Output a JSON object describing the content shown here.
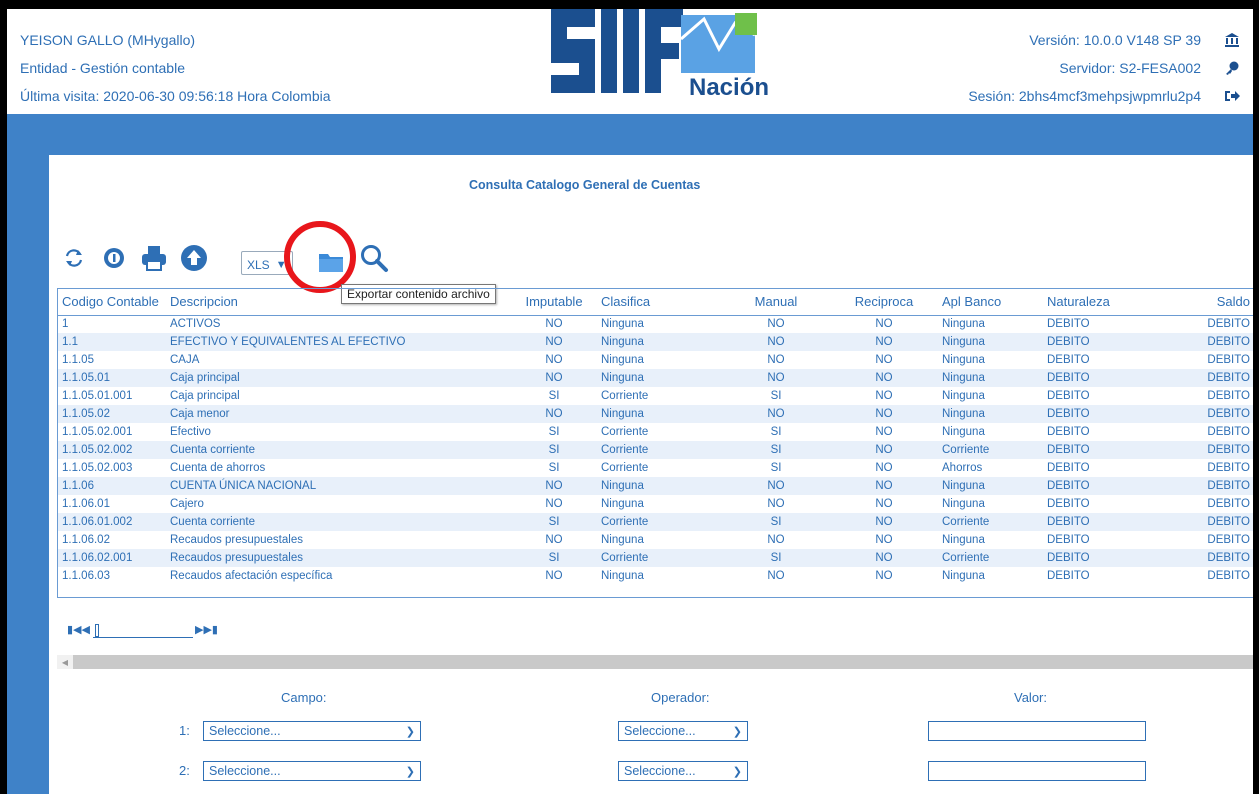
{
  "header": {
    "user": "YEISON GALLO (MHygallo)",
    "entity": "Entidad - Gestión contable",
    "last_visit": "Última visita: 2020-06-30 09:56:18 Hora Colombia",
    "version": "Versión: 10.0.0 V148 SP 39",
    "server": "Servidor: S2-FESA002",
    "session": "Sesión: 2bhs4mcf3mehpsjwpmrlu2p4",
    "logo_text": "SIIF",
    "logo_subtext": "Nación",
    "icons": [
      "bank-icon",
      "key-icon",
      "logout-icon"
    ]
  },
  "panel": {
    "title": "Consulta Catalogo General de Cuentas"
  },
  "toolbar": {
    "format_value": "XLS",
    "tooltip": "Exportar contenido archivo",
    "icons": [
      "refresh-icon",
      "info-icon",
      "print-icon",
      "upload-icon",
      "export-icon",
      "search-icon"
    ],
    "highlight_color": "#e8161b"
  },
  "table": {
    "columns": [
      "Codigo Contable",
      "Descripcion",
      "Imputable",
      "Clasifica",
      "Manual",
      "Reciproca",
      "Apl Banco",
      "Naturaleza",
      "Saldo"
    ],
    "rows": [
      [
        "1",
        "ACTIVOS",
        "NO",
        "Ninguna",
        "NO",
        "NO",
        "Ninguna",
        "DEBITO",
        "DEBITO"
      ],
      [
        "1.1",
        "EFECTIVO Y EQUIVALENTES AL EFECTIVO",
        "NO",
        "Ninguna",
        "NO",
        "NO",
        "Ninguna",
        "DEBITO",
        "DEBITO"
      ],
      [
        "1.1.05",
        "CAJA",
        "NO",
        "Ninguna",
        "NO",
        "NO",
        "Ninguna",
        "DEBITO",
        "DEBITO"
      ],
      [
        "1.1.05.01",
        "Caja principal",
        "NO",
        "Ninguna",
        "NO",
        "NO",
        "Ninguna",
        "DEBITO",
        "DEBITO"
      ],
      [
        "1.1.05.01.001",
        "Caja principal",
        "SI",
        "Corriente",
        "SI",
        "NO",
        "Ninguna",
        "DEBITO",
        "DEBITO"
      ],
      [
        "1.1.05.02",
        "Caja menor",
        "NO",
        "Ninguna",
        "NO",
        "NO",
        "Ninguna",
        "DEBITO",
        "DEBITO"
      ],
      [
        "1.1.05.02.001",
        "Efectivo",
        "SI",
        "Corriente",
        "SI",
        "NO",
        "Ninguna",
        "DEBITO",
        "DEBITO"
      ],
      [
        "1.1.05.02.002",
        "Cuenta corriente",
        "SI",
        "Corriente",
        "SI",
        "NO",
        "Corriente",
        "DEBITO",
        "DEBITO"
      ],
      [
        "1.1.05.02.003",
        "Cuenta de ahorros",
        "SI",
        "Corriente",
        "SI",
        "NO",
        "Ahorros",
        "DEBITO",
        "DEBITO"
      ],
      [
        "1.1.06",
        "CUENTA ÚNICA NACIONAL",
        "NO",
        "Ninguna",
        "NO",
        "NO",
        "Ninguna",
        "DEBITO",
        "DEBITO"
      ],
      [
        "1.1.06.01",
        "Cajero",
        "NO",
        "Ninguna",
        "NO",
        "NO",
        "Ninguna",
        "DEBITO",
        "DEBITO"
      ],
      [
        "1.1.06.01.002",
        "Cuenta corriente",
        "SI",
        "Corriente",
        "SI",
        "NO",
        "Corriente",
        "DEBITO",
        "DEBITO"
      ],
      [
        "1.1.06.02",
        "Recaudos presupuestales",
        "NO",
        "Ninguna",
        "NO",
        "NO",
        "Ninguna",
        "DEBITO",
        "DEBITO"
      ],
      [
        "1.1.06.02.001",
        "Recaudos presupuestales",
        "SI",
        "Corriente",
        "SI",
        "NO",
        "Corriente",
        "DEBITO",
        "DEBITO"
      ],
      [
        "1.1.06.03",
        "Recaudos afectación específica",
        "NO",
        "Ninguna",
        "NO",
        "NO",
        "Ninguna",
        "DEBITO",
        "DEBITO"
      ]
    ]
  },
  "filters": {
    "campo_label": "Campo:",
    "operador_label": "Operador:",
    "valor_label": "Valor:",
    "rows": [
      {
        "num": "1:",
        "campo": "Seleccione...",
        "operador": "Seleccione...",
        "valor": ""
      },
      {
        "num": "2:",
        "campo": "Seleccione...",
        "operador": "Seleccione...",
        "valor": ""
      }
    ]
  },
  "colors": {
    "accent": "#2e6fb5",
    "band": "#3f82c8",
    "row_alt": "#e8f0fa"
  }
}
